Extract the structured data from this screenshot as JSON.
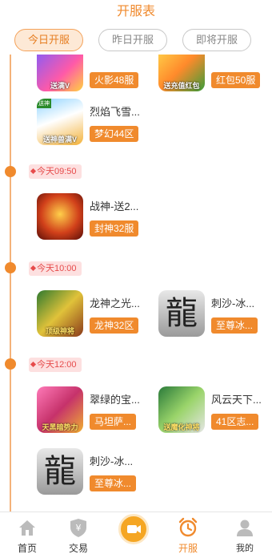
{
  "header": {
    "title": "开服表"
  },
  "tabs": [
    {
      "label": "今日开服",
      "active": true
    },
    {
      "label": "昨日开服",
      "active": false
    },
    {
      "label": "即将开服",
      "active": false
    }
  ],
  "groups": [
    {
      "games": [
        {
          "name": "",
          "badge": "火影48服",
          "icon_text": "送满V"
        },
        {
          "name": "",
          "badge": "红包50服",
          "icon_text": "送充值红包"
        },
        {
          "name": "烈焰飞雪...",
          "badge": "梦幻44区",
          "icon_text": "送神兽满V"
        }
      ]
    },
    {
      "time": "今天09:50",
      "games": [
        {
          "name": "战神-送2...",
          "badge": "封神32服",
          "icon_text": ""
        }
      ]
    },
    {
      "time": "今天10:00",
      "games": [
        {
          "name": "龙神之光...",
          "badge": "龙神32区",
          "icon_text": "顶级神将"
        },
        {
          "name": "刺沙-冰...",
          "badge": "至尊冰...",
          "icon_text": "龍"
        }
      ]
    },
    {
      "time": "今天12:00",
      "games": [
        {
          "name": "翠绿的宝...",
          "badge": "马坦萨...",
          "icon_text": "天黑暗势力"
        },
        {
          "name": "风云天下...",
          "badge": "41区志...",
          "icon_text": "送魔化神将"
        },
        {
          "name": "刺沙-冰...",
          "badge": "至尊冰...",
          "icon_text": "龍"
        }
      ]
    }
  ],
  "bottom_nav": [
    {
      "label": "首页",
      "icon": "home-icon"
    },
    {
      "label": "交易",
      "icon": "shield-yen-icon"
    },
    {
      "label": "",
      "icon": "video-icon"
    },
    {
      "label": "开服",
      "icon": "alarm-clock-icon",
      "active": true
    },
    {
      "label": "我的",
      "icon": "user-icon"
    }
  ],
  "colors": {
    "accent": "#f08a2d",
    "tag_bg": "#fde0e0",
    "tag_text": "#e64b4b",
    "line": "#f4b27a"
  }
}
